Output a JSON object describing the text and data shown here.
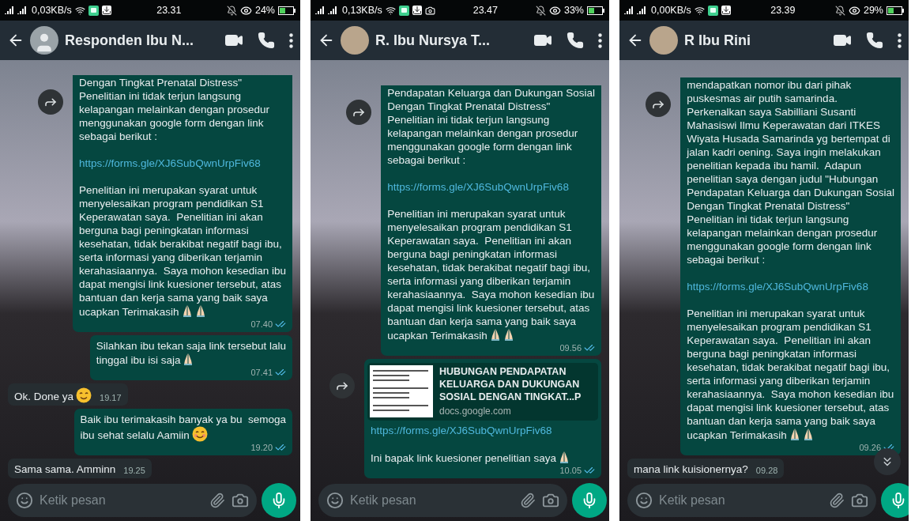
{
  "phones": [
    {
      "status_bar": {
        "speed": "0,03KB/s",
        "notifications": [
          {
            "kind": "app"
          },
          {
            "kind": "download"
          }
        ],
        "time": "23.31",
        "battery": "24%"
      },
      "header": {
        "name": "Responden Ibu N...",
        "has_photo": false
      },
      "messages": [
        {
          "kind": "outgoing",
          "forward": true,
          "clipped": true,
          "paragraphs": [
            {
              "kind": "text",
              "text": "Dengan Tingkat Prenatal Distress\"\nPenelitian ini tidak terjun langsung\nkelapangan melainkan dengan prosedur\nmenggunakan google form dengan link\nsebagai berikut :"
            },
            {
              "kind": "link",
              "text": "https://forms.gle/XJ6SubQwnUrpFiv68"
            },
            {
              "kind": "text",
              "text": "Penelitian ini merupakan syarat untuk\nmenyelesaikan program pendidikan S1\nKeperawatan saya.  Penelitian ini akan\nberguna bagi peningkatan informasi\nkesehatan, tidak berakibat negatif bagi ibu,\nserta informasi yang diberikan terjamin\nkerahasiaannya.  Saya mohon kesedian ibu\ndapat mengisi link kuesioner tersebut, atas\nbantuan dan kerja sama yang baik saya\nucapkan Terimakasih",
              "emojis": [
                {
                  "kind": "pray"
                },
                {
                  "kind": "pray"
                }
              ]
            }
          ],
          "time": "07.40",
          "read": true
        },
        {
          "kind": "outgoing",
          "forward": false,
          "clipped": false,
          "paragraphs": [
            {
              "kind": "text",
              "text": "Silahkan ibu tekan saja link tersebut lalu\ntinggal ibu isi saja",
              "emojis": [
                {
                  "kind": "pray"
                }
              ]
            }
          ],
          "time": "07.41",
          "read": true
        },
        {
          "kind": "incoming",
          "forward": false,
          "clipped": false,
          "paragraphs": [
            {
              "kind": "text",
              "text": "Ok. Done ya",
              "emojis": [
                {
                  "kind": "smile"
                }
              ]
            }
          ],
          "time": "19.17"
        },
        {
          "kind": "outgoing",
          "forward": false,
          "clipped": false,
          "paragraphs": [
            {
              "kind": "text",
              "text": "Baik ibu terimakasih banyak ya bu  semoga\nibu sehat selalu Aamiin",
              "emojis": [
                {
                  "kind": "blush"
                }
              ]
            }
          ],
          "time": "19.20",
          "read": true
        },
        {
          "kind": "incoming",
          "forward": false,
          "clipped": false,
          "paragraphs": [
            {
              "kind": "text",
              "text": "Sama sama. Amminn"
            }
          ],
          "time": "19.25"
        }
      ],
      "scroll_down": false,
      "input": {
        "placeholder": "Ketik pesan"
      }
    },
    {
      "status_bar": {
        "speed": "0,13KB/s",
        "notifications": [
          {
            "kind": "app"
          },
          {
            "kind": "download"
          },
          {
            "kind": "camera"
          }
        ],
        "time": "23.47",
        "battery": "33%"
      },
      "header": {
        "name": "R. Ibu  Nursya T...",
        "has_photo": true
      },
      "messages": [
        {
          "kind": "outgoing",
          "forward": true,
          "clipped": true,
          "paragraphs": [
            {
              "kind": "text",
              "text": "Pendapatan Keluarga dan Dukungan Sosial\nDengan Tingkat Prenatal Distress\"\nPenelitian ini tidak terjun langsung\nkelapangan melainkan dengan prosedur\nmenggunakan google form dengan link\nsebagai berikut :"
            },
            {
              "kind": "link",
              "text": "https://forms.gle/XJ6SubQwnUrpFiv68"
            },
            {
              "kind": "text",
              "text": "Penelitian ini merupakan syarat untuk\nmenyelesaikan program pendidikan S1\nKeperawatan saya.  Penelitian ini akan\nberguna bagi peningkatan informasi\nkesehatan, tidak berakibat negatif bagi ibu,\nserta informasi yang diberikan terjamin\nkerahasiaannya.  Saya mohon kesedian ibu\ndapat mengisi link kuesioner tersebut, atas\nbantuan dan kerja sama yang baik saya\nucapkan Terimakasih",
              "emojis": [
                {
                  "kind": "pray"
                },
                {
                  "kind": "pray"
                }
              ]
            }
          ],
          "time": "09.56",
          "read": true
        },
        {
          "kind": "outgoing",
          "forward": true,
          "clipped": false,
          "preview": {
            "title": "HUBUNGAN PENDAPATAN KELUARGA DAN DUKUNGAN SOSIAL DENGAN TINGKAT...P",
            "domain": "docs.google.com"
          },
          "paragraphs": [
            {
              "kind": "link",
              "text": "https://forms.gle/XJ6SubQwnUrpFiv68"
            },
            {
              "kind": "text",
              "text": "Ini bapak link kuesioner penelitian saya",
              "emojis": [
                {
                  "kind": "pray"
                }
              ]
            }
          ],
          "time": "10.05",
          "read": true
        }
      ],
      "scroll_down": false,
      "input": {
        "placeholder": "Ketik pesan"
      }
    },
    {
      "status_bar": {
        "speed": "0,00KB/s",
        "notifications": [
          {
            "kind": "app"
          },
          {
            "kind": "download"
          }
        ],
        "time": "23.39",
        "battery": "29%"
      },
      "header": {
        "name": "R Ibu Rini",
        "has_photo": true
      },
      "messages": [
        {
          "kind": "outgoing",
          "forward": true,
          "clipped": true,
          "paragraphs": [
            {
              "kind": "text",
              "text": "mendapatkan nomor ibu dari pihak\npuskesmas air putih samarinda.\nPerkenalkan saya Sabilliani Susanti\nMahasiswi Ilmu Keperawatan dari ITKES\nWiyata Husada Samarinda yg bertempat di\njalan kadri oening. Saya ingin melakukan\npenelitian kepada ibu hamil.  Adapun\npenelitian saya dengan judul \"Hubungan\nPendapatan Keluarga dan Dukungan Sosial\nDengan Tingkat Prenatal Distress\"\nPenelitian ini tidak terjun langsung\nkelapangan melainkan dengan prosedur\nmenggunakan google form dengan link\nsebagai berikut :"
            },
            {
              "kind": "link",
              "text": "https://forms.gle/XJ6SubQwnUrpFiv68"
            },
            {
              "kind": "text",
              "text": "Penelitian ini merupakan syarat untuk\nmenyelesaikan program pendidikan S1\nKeperawatan saya.  Penelitian ini akan\nberguna bagi peningkatan informasi\nkesehatan, tidak berakibat negatif bagi ibu,\nserta informasi yang diberikan terjamin\nkerahasiaannya.  Saya mohon kesedian ibu\ndapat mengisi link kuesioner tersebut, atas\nbantuan dan kerja sama yang baik saya\nucapkan Terimakasih",
              "emojis": [
                {
                  "kind": "pray"
                },
                {
                  "kind": "pray"
                }
              ]
            }
          ],
          "time": "09.26",
          "read": true
        },
        {
          "kind": "incoming",
          "forward": false,
          "clipped": false,
          "paragraphs": [
            {
              "kind": "text",
              "text": "mana link kuisionernya?"
            }
          ],
          "time": "09.28"
        }
      ],
      "scroll_down": true,
      "input": {
        "placeholder": "Ketik pesan"
      }
    }
  ]
}
